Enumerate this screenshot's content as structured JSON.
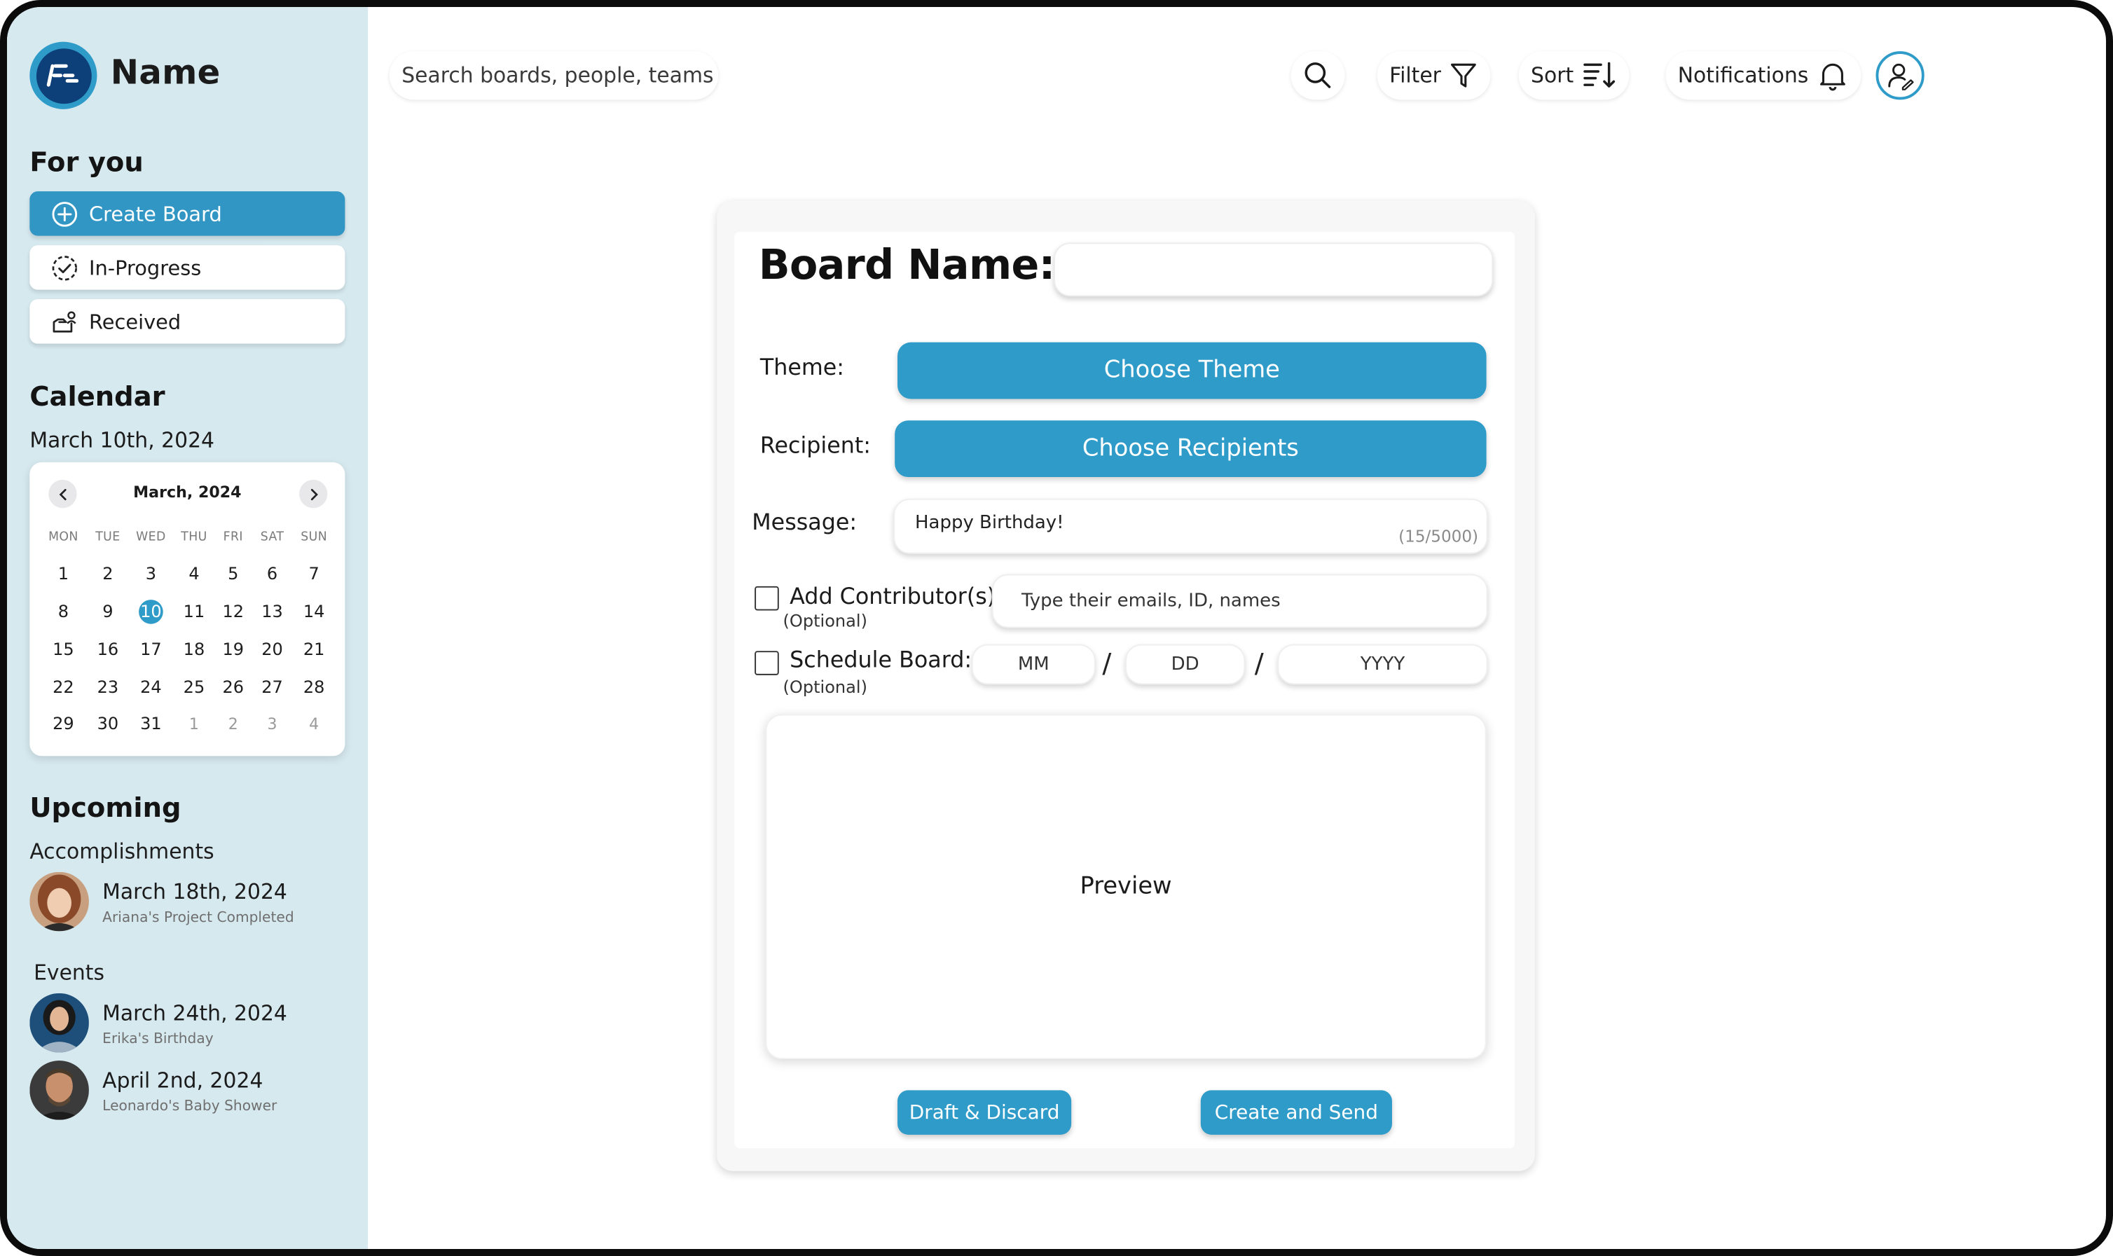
{
  "app": {
    "name": "Name"
  },
  "sidebar": {
    "for_you_title": "For you",
    "nav": [
      {
        "label": "Create Board",
        "icon": "plus-circle-icon"
      },
      {
        "label": "In-Progress",
        "icon": "progress-check-icon"
      },
      {
        "label": "Received",
        "icon": "received-icon"
      }
    ],
    "calendar_title": "Calendar",
    "current_date": "March 10th, 2024",
    "calendar": {
      "month_label": "March, 2024",
      "weekdays": [
        "MON",
        "TUE",
        "WED",
        "THU",
        "FRI",
        "SAT",
        "SUN"
      ],
      "weeks": [
        [
          "1",
          "2",
          "3",
          "4",
          "5",
          "6",
          "7"
        ],
        [
          "8",
          "9",
          "10",
          "11",
          "12",
          "13",
          "14"
        ],
        [
          "15",
          "16",
          "17",
          "18",
          "19",
          "20",
          "21"
        ],
        [
          "22",
          "23",
          "24",
          "25",
          "26",
          "27",
          "28"
        ],
        [
          "29",
          "30",
          "31",
          "1",
          "2",
          "3",
          "4"
        ]
      ],
      "selected_day": "10"
    },
    "upcoming_title": "Upcoming",
    "accomplishments_title": "Accomplishments",
    "accomplishments": [
      {
        "date": "March 18th, 2024",
        "description": "Ariana's Project Completed"
      }
    ],
    "events_title": "Events",
    "events": [
      {
        "date": "March 24th, 2024",
        "description": "Erika's Birthday"
      },
      {
        "date": "April 2nd, 2024",
        "description": "Leonardo's Baby Shower"
      }
    ]
  },
  "topbar": {
    "search_placeholder": "Search boards, people, teams",
    "filter_label": "Filter",
    "sort_label": "Sort",
    "notifications_label": "Notifications"
  },
  "form": {
    "board_name_label": "Board Name:",
    "board_name_value": "",
    "theme_label": "Theme:",
    "theme_button": "Choose Theme",
    "recipient_label": "Recipient:",
    "recipient_button": "Choose Recipients",
    "message_label": "Message:",
    "message_value": "Happy Birthday!",
    "message_counter": "(15/5000)",
    "contributors_label": "Add Contributor(s):",
    "contributors_optional": "(Optional)",
    "contributors_placeholder": "Type their emails, ID, names",
    "schedule_label": "Schedule Board:",
    "schedule_optional": "(Optional)",
    "month_placeholder": "MM",
    "day_placeholder": "DD",
    "year_placeholder": "YYYY",
    "date_separator": "/",
    "preview_label": "Preview",
    "draft_button": "Draft & Discard",
    "create_button": "Create and Send"
  },
  "colors": {
    "accent": "#2f9bc9",
    "sidebar_bg": "#d6e9ef",
    "logo_navy": "#0d3f78"
  }
}
